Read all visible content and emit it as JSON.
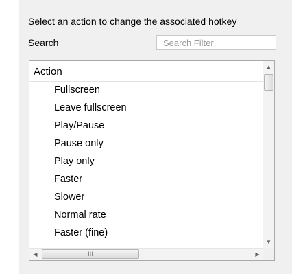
{
  "instructions": "Select an action to change the associated hotkey",
  "search": {
    "label": "Search",
    "placeholder": "Search Filter",
    "value": ""
  },
  "table": {
    "column_header": "Action",
    "rows": [
      "Fullscreen",
      "Leave fullscreen",
      "Play/Pause",
      "Pause only",
      "Play only",
      "Faster",
      "Slower",
      "Normal rate",
      "Faster (fine)"
    ]
  },
  "scrollbars": {
    "up_icon": "arrow-up-icon",
    "down_icon": "arrow-down-icon",
    "left_icon": "arrow-left-icon",
    "right_icon": "arrow-right-icon",
    "grip_glyph": "III"
  }
}
